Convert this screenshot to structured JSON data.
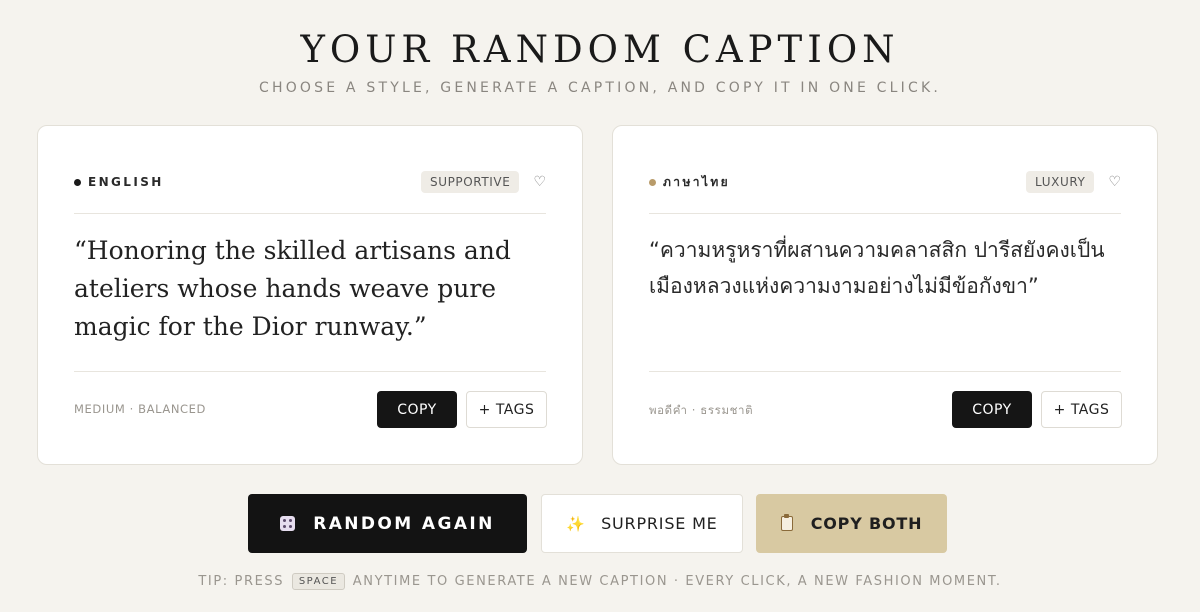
{
  "header": {
    "title": "YOUR RANDOM CAPTION",
    "subtitle": "CHOOSE A STYLE, GENERATE A CAPTION, AND COPY IT IN ONE CLICK."
  },
  "cards": [
    {
      "language": "ENGLISH",
      "dot_color": "#1a1a1a",
      "tone": "SUPPORTIVE",
      "quote": "“Honoring the skilled artisans and ateliers whose hands weave pure magic for the Dior runway.”",
      "meta": "MEDIUM · BALANCED",
      "copy_label": "COPY",
      "tags_label": "+ TAGS"
    },
    {
      "language": "ภาษาไทย",
      "dot_color": "#b89b6a",
      "tone": "LUXURY",
      "quote": "“ความหรูหราที่ผสานความคลาสสิก ปารีสยังคงเป็นเมืองหลวงแห่งความงามอย่างไม่มีข้อกังขา”",
      "meta": "พอดีคำ · ธรรมชาติ",
      "copy_label": "COPY",
      "tags_label": "+ TAGS"
    }
  ],
  "actions": {
    "random_label": "RANDOM AGAIN",
    "surprise_label": "SURPRISE ME",
    "copy_both_label": "COPY BOTH"
  },
  "tip": {
    "prefix": "TIP: PRESS",
    "key": "SPACE",
    "suffix": "ANYTIME TO GENERATE A NEW CAPTION · EVERY CLICK, A NEW FASHION MOMENT."
  },
  "icons": {
    "random": "dice-icon",
    "surprise": "sparkles-icon",
    "copy_both": "clipboard-icon",
    "favorite": "heart-icon"
  },
  "colors": {
    "background": "#f5f3ee",
    "primary_button": "#131313",
    "accent_gold": "#d8c9a2"
  }
}
